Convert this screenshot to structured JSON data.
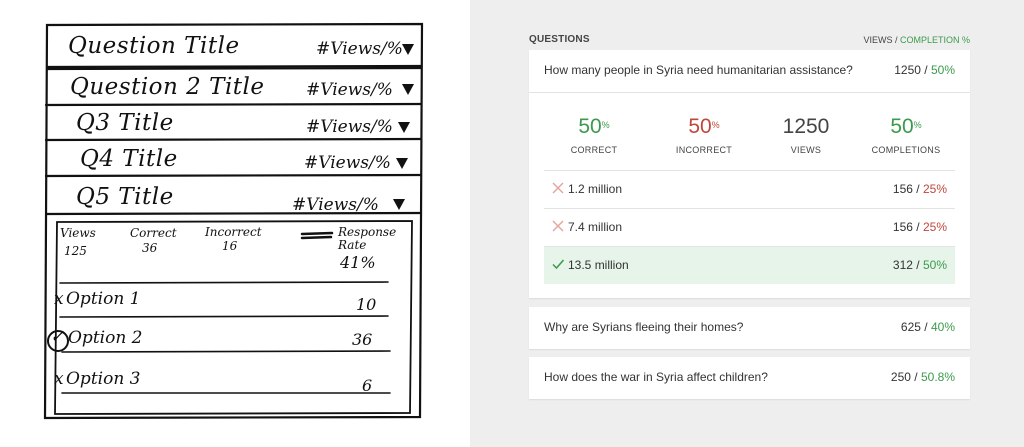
{
  "sketch": {
    "rows": [
      {
        "title": "Question Title",
        "metric": "#Views/%"
      },
      {
        "title": "Question 2 Title",
        "metric": "#Views/%"
      },
      {
        "title": "Q3 Title",
        "metric": "#Views/%"
      },
      {
        "title": "Q4 Title",
        "metric": "#Views/%"
      },
      {
        "title": "Q5 Title",
        "metric": "#Views/%"
      }
    ],
    "stats": [
      {
        "label": "Views",
        "value": "125"
      },
      {
        "label": "Correct",
        "value": "36"
      },
      {
        "label": "Incorrect",
        "value": "16"
      },
      {
        "label": "Response Rate",
        "value": "41%"
      }
    ],
    "options": [
      {
        "mark": "x",
        "label": "Option 1",
        "value": "10"
      },
      {
        "mark": "✓",
        "label": "Option 2",
        "value": "36"
      },
      {
        "mark": "x",
        "label": "Option 3",
        "value": "6"
      }
    ]
  },
  "panel": {
    "section_title": "QUESTIONS",
    "col_views": "VIEWS",
    "col_sep": " / ",
    "col_completion": "COMPLETION %",
    "questions": [
      {
        "text": "How many people in Syria need humanitarian assistance?",
        "views": "1250",
        "sep": " / ",
        "completion": "50%"
      },
      {
        "text": "Why are Syrians fleeing their homes?",
        "views": "625",
        "sep": " / ",
        "completion": "40%"
      },
      {
        "text": "How does the war in Syria affect children?",
        "views": "250",
        "sep": " / ",
        "completion": "50.8%"
      }
    ],
    "stats": [
      {
        "value": "50",
        "unit": "%",
        "label": "CORRECT",
        "color": "#3c9a4c"
      },
      {
        "value": "50",
        "unit": "%",
        "label": "INCORRECT",
        "color": "#c0473c"
      },
      {
        "value": "1250",
        "unit": "",
        "label": "VIEWS",
        "color": "#444444"
      },
      {
        "value": "50",
        "unit": "%",
        "label": "COMPLETIONS",
        "color": "#3c9a4c"
      }
    ],
    "options": [
      {
        "icon": "x-icon",
        "label": "1.2 million",
        "count": "156",
        "sep": " / ",
        "pct": "25%",
        "correct": false
      },
      {
        "icon": "x-icon",
        "label": "7.4 million",
        "count": "156",
        "sep": " / ",
        "pct": "25%",
        "correct": false
      },
      {
        "icon": "check-icon",
        "label": "13.5 million",
        "count": "312",
        "sep": " / ",
        "pct": "50%",
        "correct": true
      }
    ]
  }
}
